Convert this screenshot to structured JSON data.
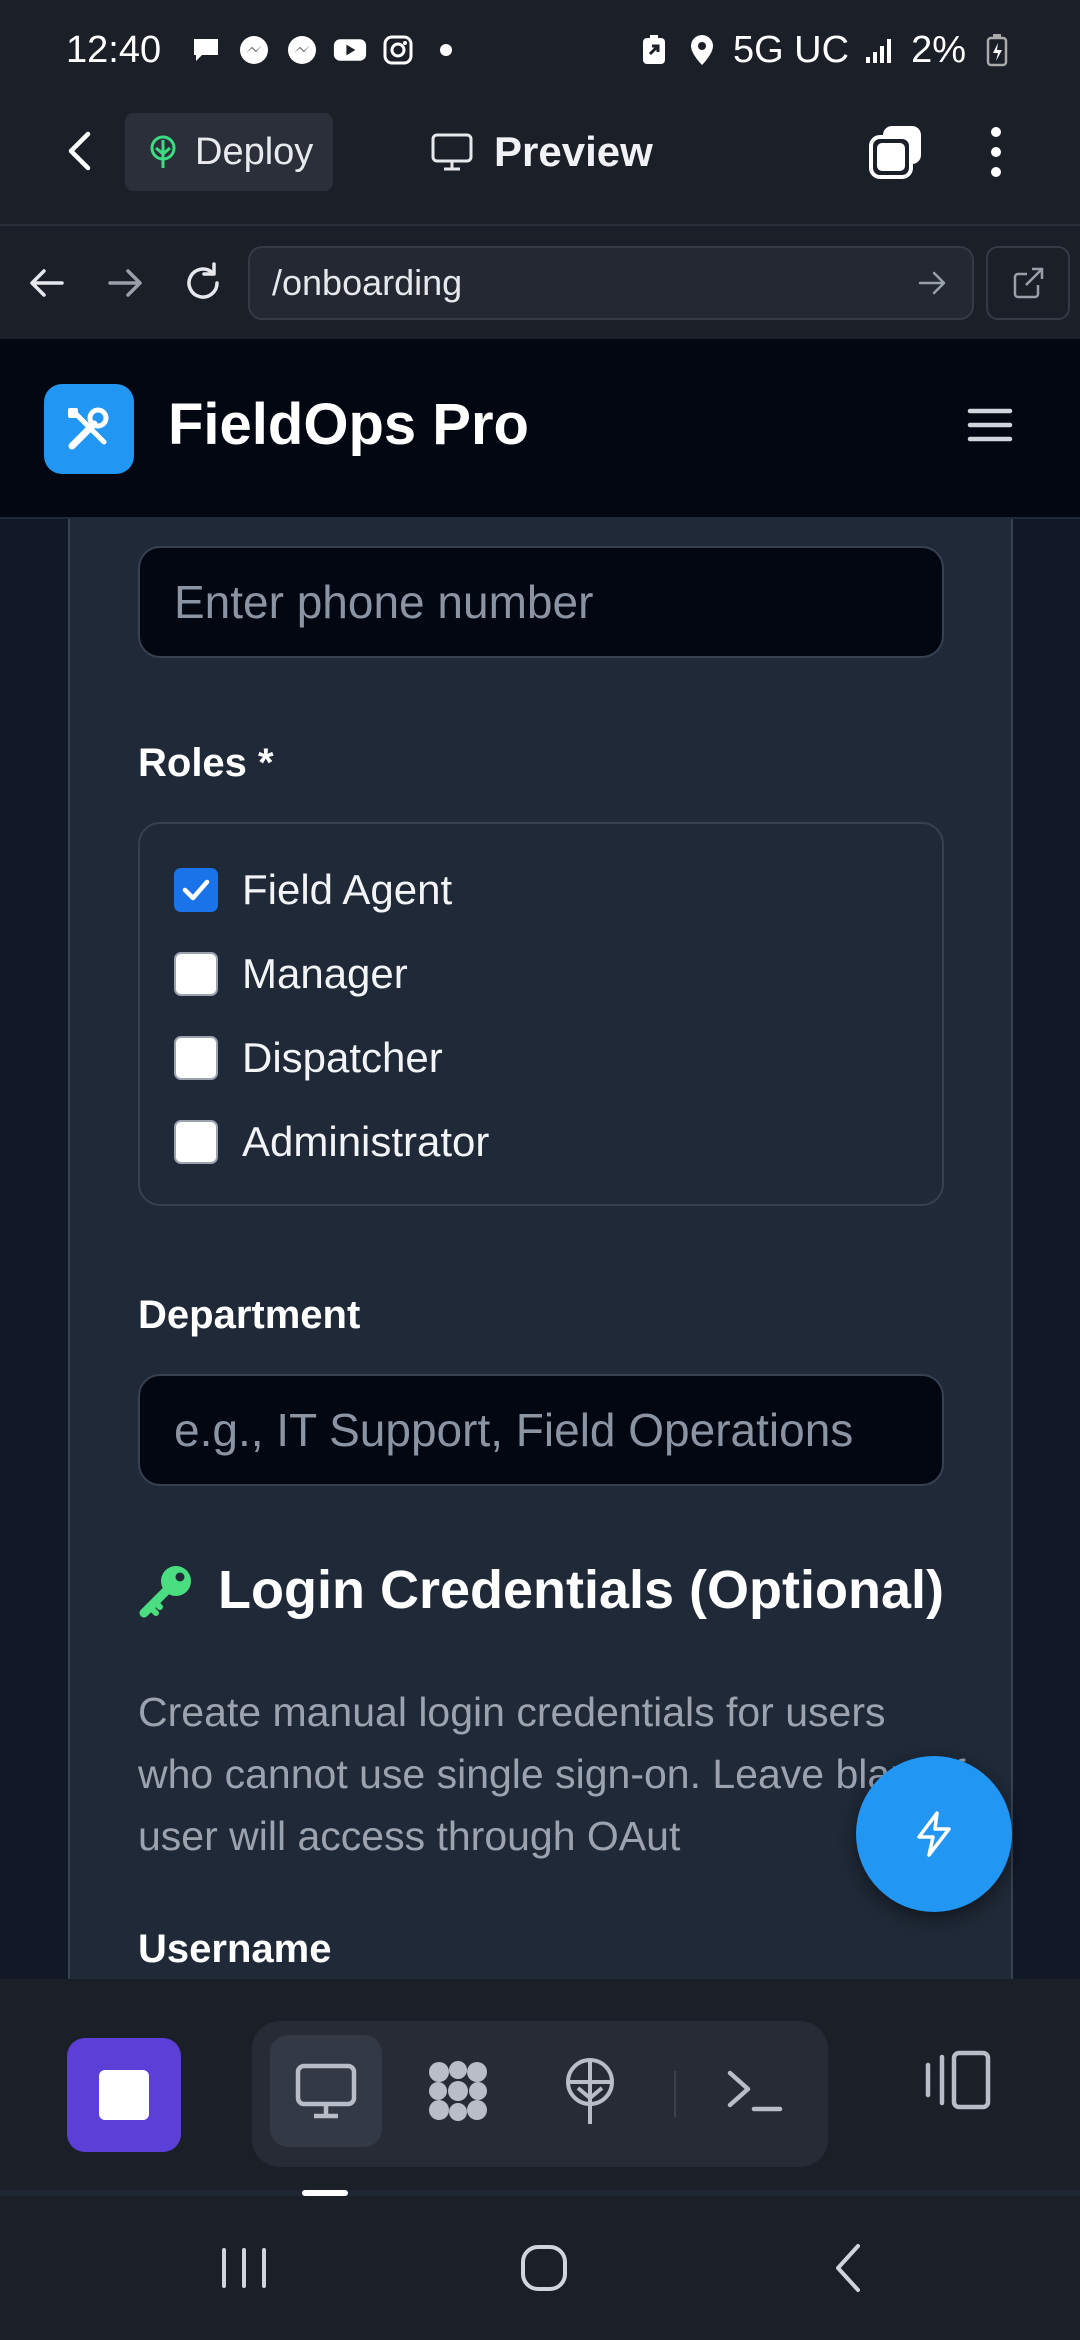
{
  "status_bar": {
    "time": "12:40",
    "network": "5G UC",
    "battery": "2%",
    "icons": [
      "chat-bubble-icon",
      "messenger-icon",
      "messenger-icon",
      "youtube-icon",
      "instagram-icon",
      "dot-icon",
      "battery-saver-icon",
      "location-icon",
      "signal-icon",
      "battery-icon"
    ]
  },
  "app_bar": {
    "deploy_label": "Deploy",
    "preview_label": "Preview"
  },
  "browser": {
    "url": "/onboarding"
  },
  "app_header": {
    "brand": "FieldOps Pro"
  },
  "form": {
    "phone_placeholder": "Enter phone number",
    "roles_label": "Roles *",
    "roles": [
      {
        "label": "Field Agent",
        "checked": true
      },
      {
        "label": "Manager",
        "checked": false
      },
      {
        "label": "Dispatcher",
        "checked": false
      },
      {
        "label": "Administrator",
        "checked": false
      }
    ],
    "department_label": "Department",
    "department_placeholder": "e.g., IT Support, Field Operations",
    "credentials_title": "Login Credentials (Optional)",
    "credentials_desc": "Create manual login credentials for users who cannot use single sign-on. Leave blank if user will access through OAut",
    "username_label": "Username"
  },
  "colors": {
    "accent": "#2196f3",
    "checkbox_checked": "#1a73e8",
    "stop_button": "#5b3fd6",
    "key_icon": "#4ade80"
  }
}
